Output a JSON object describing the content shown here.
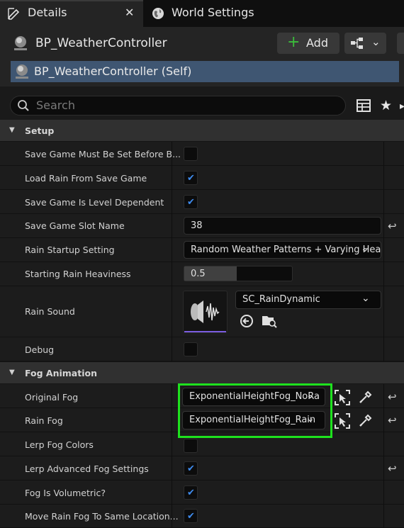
{
  "tabs": [
    {
      "label": "Details",
      "icon": "pencil-icon",
      "active": true,
      "close": "✕"
    },
    {
      "label": "World Settings",
      "icon": "globe-icon",
      "active": false
    }
  ],
  "header": {
    "actor_name": "BP_WeatherController",
    "add_label": "Add",
    "self_label": "BP_WeatherController (Self)"
  },
  "search": {
    "placeholder": "Search"
  },
  "categories": [
    {
      "label": "Setup",
      "properties": [
        {
          "label": "Save Game Must Be Set Before B...",
          "type": "checkbox",
          "checked": false
        },
        {
          "label": "Load Rain From Save Game",
          "type": "checkbox",
          "checked": true
        },
        {
          "label": "Save Game Is Level Dependent",
          "type": "checkbox",
          "checked": true
        },
        {
          "label": "Save Game Slot Name",
          "type": "text",
          "value": "38",
          "resettable": true
        },
        {
          "label": "Rain Startup Setting",
          "type": "combo",
          "value": "Random Weather Patterns + Varying Hea"
        },
        {
          "label": "Starting Rain Heaviness",
          "type": "slider",
          "value": "0.5",
          "fraction": 0.5
        },
        {
          "label": "Rain Sound",
          "type": "asset",
          "value": "SC_RainDynamic"
        },
        {
          "label": "Debug",
          "type": "checkbox",
          "checked": false
        }
      ]
    },
    {
      "label": "Fog Animation",
      "properties": [
        {
          "label": "Original Fog",
          "type": "actor",
          "value": "ExponentialHeightFog_NoRa",
          "resettable": true
        },
        {
          "label": "Rain Fog",
          "type": "actor",
          "value": "ExponentialHeightFog_Rain",
          "resettable": true
        },
        {
          "label": "Lerp Fog Colors",
          "type": "checkbox",
          "checked": false
        },
        {
          "label": "Lerp Advanced Fog Settings",
          "type": "checkbox",
          "checked": true,
          "resettable": true
        },
        {
          "label": "Fog Is Volumetric?",
          "type": "checkbox",
          "checked": true
        },
        {
          "label": "Move Rain Fog To Same Location...",
          "type": "checkbox",
          "checked": true
        }
      ]
    }
  ],
  "colors": {
    "accent_check": "#3f8cf0",
    "add_green": "#3bbd3b",
    "highlight": "#1ee21e",
    "selected_row": "#3f5672"
  }
}
